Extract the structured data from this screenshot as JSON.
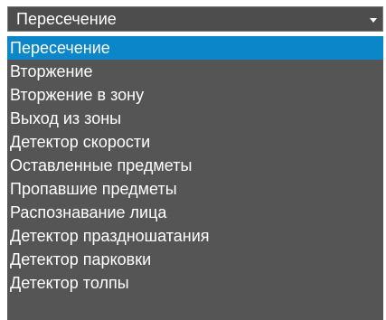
{
  "select": {
    "value": "Пересечение",
    "chevron_icon": "chevron-down-icon"
  },
  "options": [
    {
      "label": "Пересечение",
      "selected": true
    },
    {
      "label": "Вторжение",
      "selected": false
    },
    {
      "label": "Вторжение в зону",
      "selected": false
    },
    {
      "label": "Выход из зоны",
      "selected": false
    },
    {
      "label": "Детектор скорости",
      "selected": false
    },
    {
      "label": "Оставленные предметы",
      "selected": false
    },
    {
      "label": "Пропавшие предметы",
      "selected": false
    },
    {
      "label": "Распознавание лица",
      "selected": false
    },
    {
      "label": "Детектор праздношатания",
      "selected": false
    },
    {
      "label": "Детектор парковки",
      "selected": false
    },
    {
      "label": "Детектор толпы",
      "selected": false
    }
  ],
  "colors": {
    "select_background": "#4d4d4d",
    "list_background": "#555555",
    "selected_highlight": "#0a86c9",
    "text": "#ffffff"
  }
}
